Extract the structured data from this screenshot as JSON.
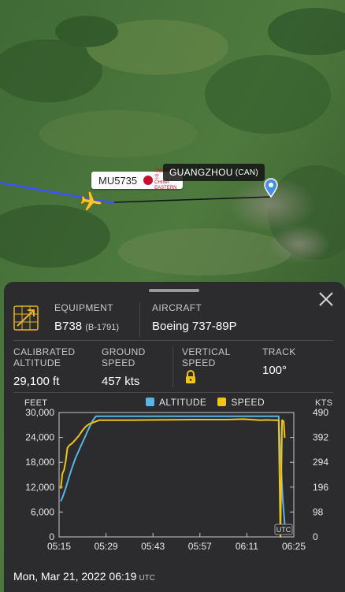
{
  "map": {
    "flight_label": "MU5735",
    "airline_logo_text": "中国东方航空 CHINA EASTERN",
    "destination": {
      "name": "GUANGZHOU",
      "code": "(CAN)"
    },
    "icons": [
      "airplane-icon",
      "location-pin-icon"
    ],
    "colors": {
      "route_flown": "#3a52ff",
      "route_planned": "#1a1a1a",
      "plane": "#f7c52a",
      "pin": "#4a90e2"
    }
  },
  "panel": {
    "equipment": {
      "label": "EQUIPMENT",
      "value": "B738",
      "reg": "(B-1791)"
    },
    "aircraft": {
      "label": "AIRCRAFT",
      "value": "Boeing 737-89P"
    },
    "stats": [
      {
        "label_line1": "CALIBRATED",
        "label_line2": "ALTITUDE",
        "value": "29,100 ft"
      },
      {
        "label_line1": "GROUND",
        "label_line2": "SPEED",
        "value": "457 kts"
      },
      {
        "label_line1": "VERTICAL",
        "label_line2": "SPEED",
        "value": ""
      },
      {
        "label_line1": "TRACK",
        "label_line2": "",
        "value": "100°"
      }
    ],
    "date": "Mon, Mar 21, 2022",
    "time": "06:19",
    "tz": "UTC"
  },
  "chart_data": {
    "type": "line",
    "legend": [
      "ALTITUDE",
      "SPEED"
    ],
    "left_unit": "FEET",
    "right_unit": "KTS",
    "left_ticks": [
      "30,000",
      "24,000",
      "18,000",
      "12,000",
      "6,000",
      "0"
    ],
    "right_ticks": [
      "490",
      "392",
      "294",
      "196",
      "98",
      "0"
    ],
    "x_ticks": [
      "05:15",
      "05:29",
      "05:43",
      "05:57",
      "06:11",
      "06:25"
    ],
    "x_tick_minutes": [
      0,
      14,
      28,
      42,
      56,
      70
    ],
    "utc_label": "UTC",
    "ylim_left": [
      0,
      30000
    ],
    "ylim_right": [
      0,
      490
    ],
    "colors": {
      "altitude": "#5ab4e6",
      "speed": "#f0c419"
    },
    "series": [
      {
        "name": "ALTITUDE",
        "axis": "left",
        "x": [
          0.5,
          1,
          2,
          3,
          4,
          5,
          6,
          7,
          8,
          9,
          10,
          11,
          13,
          20,
          30,
          40,
          50,
          60,
          65.5,
          66,
          66.7,
          67.3
        ],
        "values": [
          8600,
          9500,
          11800,
          14500,
          17000,
          19200,
          21000,
          22800,
          24600,
          26400,
          28000,
          29100,
          29100,
          29100,
          29100,
          29100,
          29100,
          29100,
          29100,
          20000,
          9000,
          3000
        ]
      },
      {
        "name": "SPEED",
        "axis": "right",
        "x": [
          0.5,
          1,
          1.5,
          2,
          2.5,
          3,
          4,
          5,
          6,
          7,
          8,
          9,
          10,
          11,
          12,
          20,
          30,
          40,
          50,
          55,
          60,
          62,
          64,
          65.5,
          66,
          66.5,
          67,
          67.3
        ],
        "values": [
          190,
          250,
          265,
          300,
          350,
          360,
          370,
          385,
          400,
          420,
          435,
          445,
          450,
          455,
          460,
          460,
          461,
          462,
          462,
          464,
          460,
          461,
          460,
          460,
          0,
          460,
          455,
          390
        ]
      }
    ]
  }
}
